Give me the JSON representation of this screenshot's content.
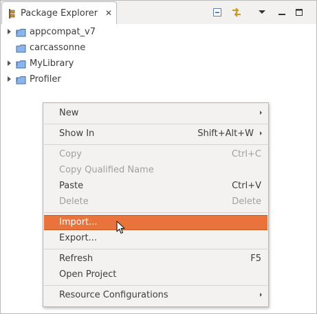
{
  "view": {
    "tab_title": "Package Explorer",
    "close_glyph": "✕",
    "toolbar": {
      "collapse_all": "collapse-all-icon",
      "link_with_editor": "link-with-editor-icon",
      "view_menu": "view-menu-icon",
      "minimize": "minimize-icon",
      "maximize": "maximize-icon"
    }
  },
  "tree": {
    "items": [
      {
        "label": "appcompat_v7",
        "expandable": true
      },
      {
        "label": "carcassonne",
        "expandable": false
      },
      {
        "label": "MyLibrary",
        "expandable": true
      },
      {
        "label": "Profiler",
        "expandable": true
      }
    ]
  },
  "context_menu": {
    "items": [
      {
        "label": "New",
        "accelerator": "",
        "submenu": true,
        "enabled": true
      },
      {
        "label": "Show In",
        "accelerator": "Shift+Alt+W",
        "submenu": true,
        "enabled": true
      },
      {
        "label": "Copy",
        "accelerator": "Ctrl+C",
        "submenu": false,
        "enabled": false
      },
      {
        "label": "Copy Qualified Name",
        "accelerator": "",
        "submenu": false,
        "enabled": false
      },
      {
        "label": "Paste",
        "accelerator": "Ctrl+V",
        "submenu": false,
        "enabled": true
      },
      {
        "label": "Delete",
        "accelerator": "Delete",
        "submenu": false,
        "enabled": false
      },
      {
        "label": "Import...",
        "accelerator": "",
        "submenu": false,
        "enabled": true,
        "selected": true
      },
      {
        "label": "Export...",
        "accelerator": "",
        "submenu": false,
        "enabled": true
      },
      {
        "label": "Refresh",
        "accelerator": "F5",
        "submenu": false,
        "enabled": true
      },
      {
        "label": "Open Project",
        "accelerator": "",
        "submenu": false,
        "enabled": true
      },
      {
        "label": "Resource Configurations",
        "accelerator": "",
        "submenu": true,
        "enabled": true
      }
    ]
  },
  "colors": {
    "selection": "#e8733b",
    "menu_bg": "#f3f2f0",
    "disabled_text": "#a3a09c",
    "project_icon": "#4a7fc1"
  }
}
